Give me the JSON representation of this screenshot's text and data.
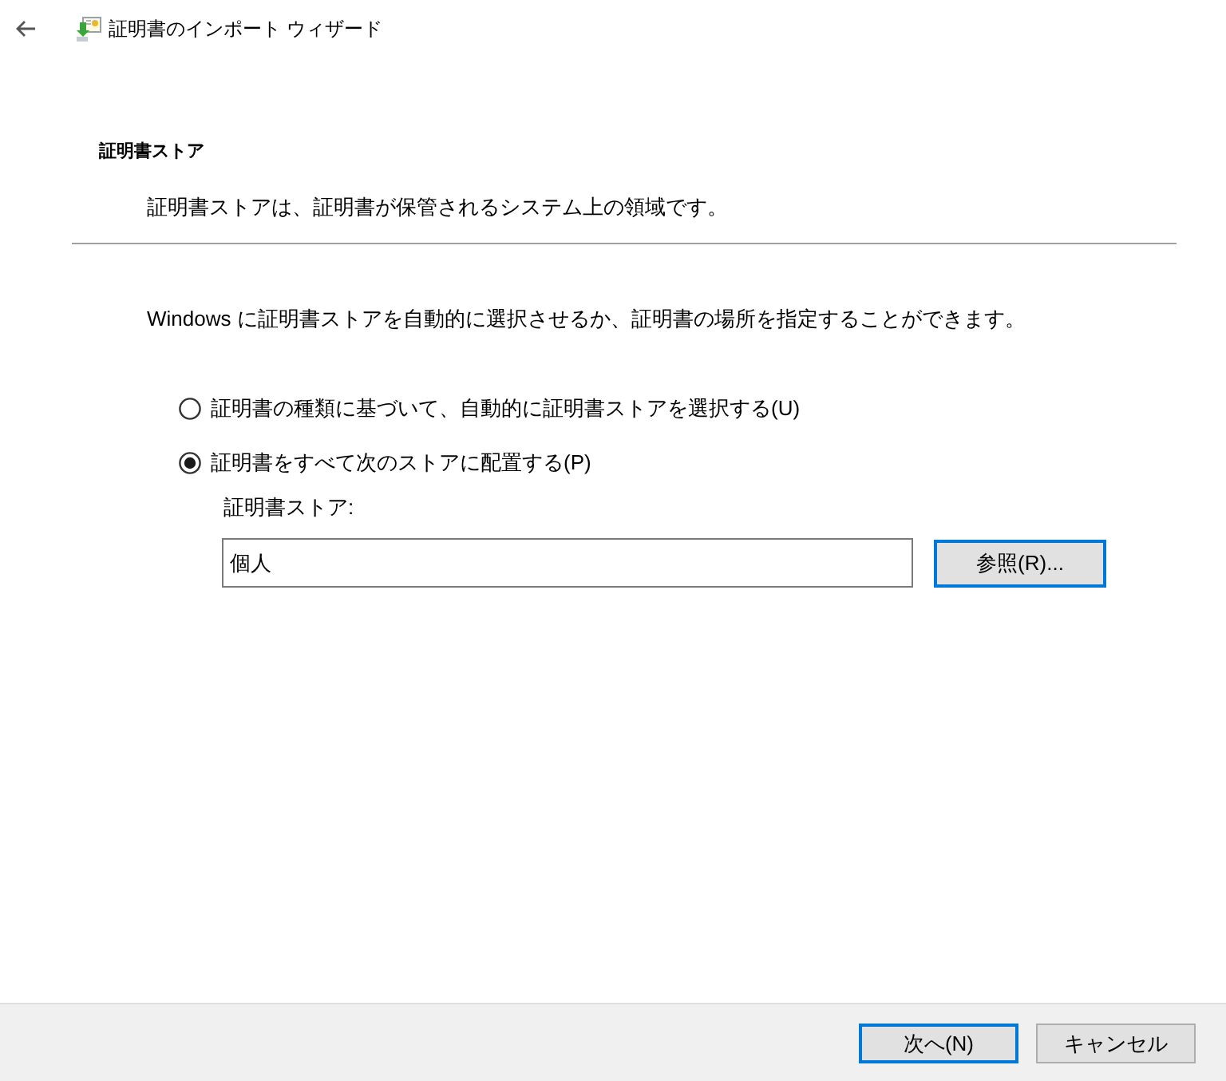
{
  "window": {
    "title": "証明書のインポート ウィザード"
  },
  "header": {
    "title": "証明書ストア",
    "description": "証明書ストアは、証明書が保管されるシステム上の領域です。"
  },
  "body": {
    "intro": "Windows に証明書ストアを自動的に選択させるか、証明書の場所を指定することができます。",
    "options": [
      {
        "label": "証明書の種類に基づいて、自動的に証明書ストアを選択する(U)",
        "selected": false
      },
      {
        "label": "証明書をすべて次のストアに配置する(P)",
        "selected": true
      }
    ],
    "store_field": {
      "label": "証明書ストア:",
      "value": "個人",
      "browse_button": {
        "label": "参照(R)...",
        "focused": true
      }
    }
  },
  "buttons": [
    {
      "label": "次へ(N)",
      "focused": true
    },
    {
      "label": "キャンセル",
      "focused": false
    }
  ]
}
